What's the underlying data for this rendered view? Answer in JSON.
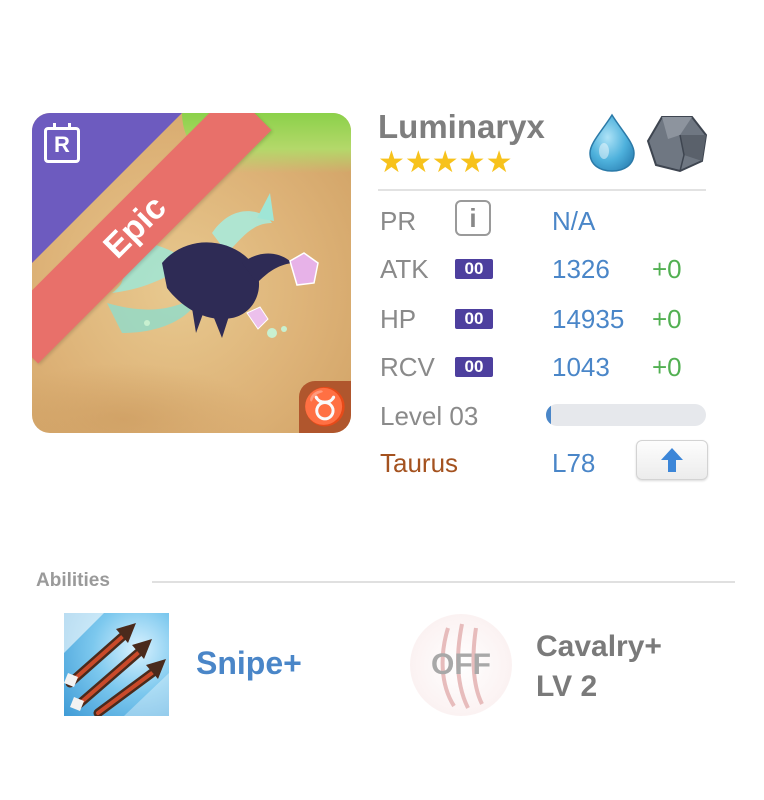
{
  "monster": {
    "rarity_badge": "R",
    "rarity_label": "Epic",
    "zodiac_symbol": "♉",
    "name": "Luminaryx",
    "stars": "★★★★★",
    "star_count": 5,
    "elements": [
      "water-icon",
      "rock-icon"
    ]
  },
  "stats": {
    "pr": {
      "label": "PR",
      "value": "N/A"
    },
    "atk": {
      "label": "ATK",
      "badge": "00",
      "value": "1326",
      "bonus": "+0"
    },
    "hp": {
      "label": "HP",
      "badge": "00",
      "value": "14935",
      "bonus": "+0"
    },
    "rcv": {
      "label": "RCV",
      "badge": "00",
      "value": "1043",
      "bonus": "+0"
    },
    "level": {
      "label": "Level 03",
      "progress": 0.03
    },
    "zodiac": {
      "label": "Taurus",
      "value": "L78"
    }
  },
  "abilities": {
    "title": "Abilities",
    "primary": {
      "name": "Snipe+",
      "icon": "arrows-icon"
    },
    "secondary": {
      "status": "OFF",
      "name": "Cavalry+",
      "level": "LV 2",
      "icon": "claw-icon"
    }
  },
  "colors": {
    "epic": "#e8706a",
    "rarity_corner": "#6d5bbf",
    "zodiac": "#b0562d",
    "value_blue": "#4a86c8",
    "bonus_green": "#52b052",
    "star_gold": "#f7c21c"
  }
}
